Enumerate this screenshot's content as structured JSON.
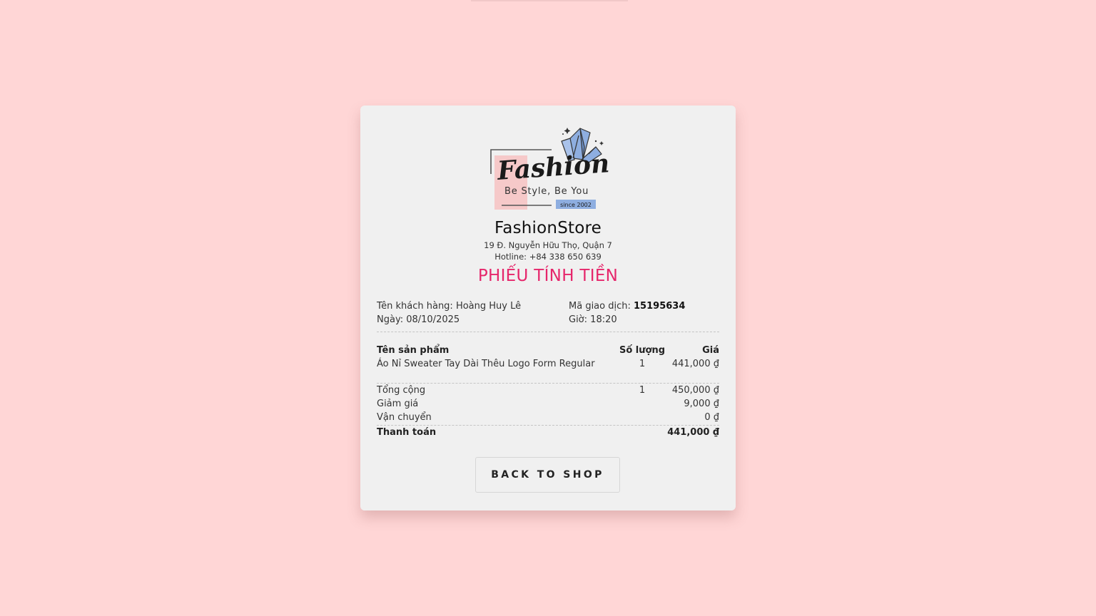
{
  "logo": {
    "brand_text": "Fashion",
    "tagline": "Be Style, Be You",
    "since": "since 2002"
  },
  "store": {
    "name": "FashionStore",
    "address": "19 Đ. Nguyễn Hữu Thọ, Quận 7",
    "hotline": "Hotline: +84 338 650 639"
  },
  "receipt": {
    "title": "PHIẾU TÍNH TIỀN",
    "customer_label": "Tên khách hàng:",
    "customer_name": "Hoàng Huy Lê",
    "date_label": "Ngày:",
    "date": "08/10/2025",
    "transaction_label": "Mã giao dịch:",
    "transaction_id": "15195634",
    "time_label": "Giờ:",
    "time": "18:20"
  },
  "table": {
    "headers": {
      "product": "Tên sản phẩm",
      "quantity": "Số lượng",
      "price": "Giá"
    },
    "items": [
      {
        "product": "Áo Nỉ Sweater Tay Dài Thêu Logo Form Regular",
        "quantity": "1",
        "price": "441,000 ₫"
      }
    ]
  },
  "summary": {
    "total_label": "Tổng cộng",
    "total_quantity": "1",
    "total_value": "450,000 ₫",
    "discount_label": "Giảm giá",
    "discount_value": "9,000 ₫",
    "shipping_label": "Vận chuyển",
    "shipping_value": "0 ₫",
    "payment_label": "Thanh toán",
    "payment_value": "441,000 ₫"
  },
  "actions": {
    "back_label": "BACK TO SHOP"
  },
  "colors": {
    "background": "#ffd6d6",
    "card": "#f0f0f0",
    "title_accent": "#e6266b",
    "logo_crystal": "#8eaee0",
    "logo_pink": "#f6c9c9"
  }
}
